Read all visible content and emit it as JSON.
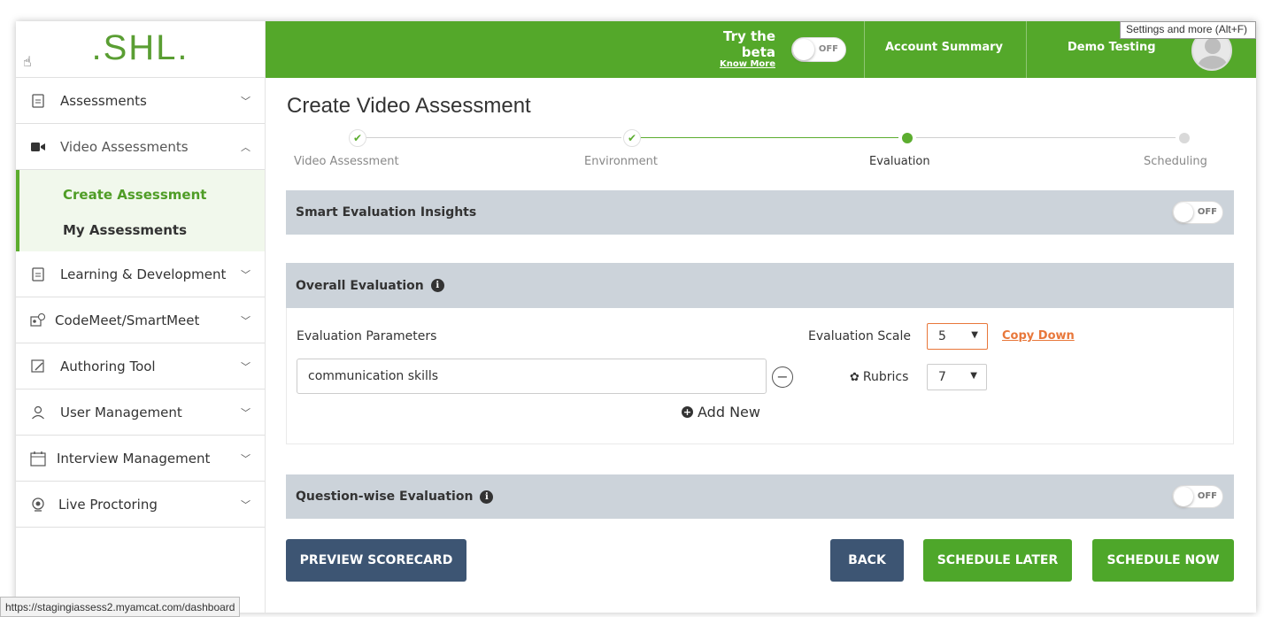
{
  "brand": {
    "logo_text": ".SHL."
  },
  "header": {
    "beta_title": "Try the beta",
    "beta_link": "Know More",
    "beta_toggle": "OFF",
    "account_summary": "Account Summary",
    "user_name": "Demo Testing",
    "tooltip": "Settings and more (Alt+F)"
  },
  "sidebar": {
    "items": [
      {
        "label": "Assessments",
        "icon": "document-icon"
      },
      {
        "label": "Video Assessments",
        "icon": "video-camera-icon"
      },
      {
        "label": "Learning & Development",
        "icon": "document-icon"
      },
      {
        "label": "CodeMeet/SmartMeet",
        "icon": "meeting-icon"
      },
      {
        "label": "Authoring Tool",
        "icon": "authoring-icon"
      },
      {
        "label": "User Management",
        "icon": "user-icon"
      },
      {
        "label": "Interview Management",
        "icon": "calendar-icon"
      },
      {
        "label": "Live Proctoring",
        "icon": "webcam-icon"
      }
    ],
    "subitems": [
      {
        "label": "Create Assessment"
      },
      {
        "label": "My Assessments"
      }
    ]
  },
  "page": {
    "title": "Create Video Assessment",
    "steps": [
      {
        "label": "Video Assessment",
        "state": "done"
      },
      {
        "label": "Environment",
        "state": "done"
      },
      {
        "label": "Evaluation",
        "state": "active"
      },
      {
        "label": "Scheduling",
        "state": "pending"
      }
    ],
    "smart_insights": {
      "title": "Smart Evaluation Insights",
      "toggle": "OFF"
    },
    "overall": {
      "title": "Overall Evaluation",
      "params_label": "Evaluation Parameters",
      "scale_label": "Evaluation Scale",
      "scale_value": "5",
      "copy_down": "Copy Down",
      "param_value": "communication skills",
      "rubrics_label": "Rubrics",
      "rubrics_value": "7",
      "add_new": "Add New"
    },
    "question_wise": {
      "title": "Question-wise Evaluation",
      "toggle": "OFF"
    },
    "buttons": {
      "preview": "PREVIEW SCORECARD",
      "back": "BACK",
      "schedule_later": "SCHEDULE LATER",
      "schedule_now": "SCHEDULE NOW"
    }
  },
  "status_url": "https://stagingiassess2.myamcat.com/dashboard",
  "colors": {
    "brand_green": "#54a82a",
    "panel_gray": "#ccd3da",
    "dark_button": "#3d5573",
    "accent_orange": "#e8773a"
  }
}
